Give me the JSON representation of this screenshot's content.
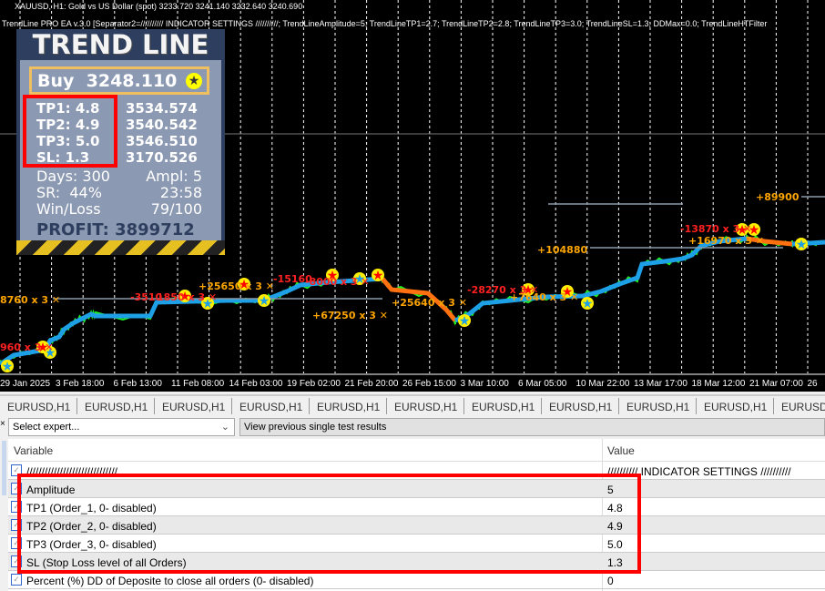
{
  "chart": {
    "header_line1": "XAUUSD, H1:  Gold vs US Dollar (spot)  3233.720 3241.140 3232.640 3240.690",
    "header_line2": "TrendLine PRO EA  v.3.0 [Separator2=////////// INDICATOR SETTINGS //////////; TrendLineAmplitude=5; TrendLineTP1=2.7; TrendLineTP2=2.8; TrendLineTP3=3.0; TrendLineSL=1.3; DDMax=0.0; TrendLineHTFilter",
    "x_ticks": [
      "29 Jan 2025",
      "3 Feb 18:00",
      "6 Feb 13:00",
      "11 Feb 08:00",
      "14 Feb 03:00",
      "19 Feb 02:00",
      "21 Feb 20:00",
      "26 Feb 15:00",
      "3 Mar 10:00",
      "6 Mar 05:00",
      "10 Mar 22:00",
      "13 Mar 17:00",
      "18 Mar 12:00",
      "21 Mar 07:00",
      "26"
    ],
    "trade_labels": [
      {
        "text": "8760 x 3",
        "color": "#ffa500"
      },
      {
        "text": "960 x 3",
        "color": "#ff2020"
      },
      {
        "text": "-3510",
        "color": "#ff2020"
      },
      {
        "text": "1850 x 3",
        "color": "#ff2020"
      },
      {
        "text": "+25650 x 3",
        "color": "#ffa500"
      },
      {
        "text": "-15160",
        "color": "#ff2020"
      },
      {
        "text": "-8000 x 3",
        "color": "#ff2020"
      },
      {
        "text": "+67250 x 3",
        "color": "#ffa500"
      },
      {
        "text": "+25640 x 3",
        "color": "#ffa500"
      },
      {
        "text": "-28270 x 3",
        "color": "#ff2020"
      },
      {
        "text": "+7640 x 3",
        "color": "#ffa500"
      },
      {
        "text": "+104880",
        "color": "#ffa500"
      },
      {
        "text": "-13870 x 3",
        "color": "#ff2020"
      },
      {
        "text": "+16970 x 3",
        "color": "#ffa500"
      },
      {
        "text": "+89900",
        "color": "#ffa500"
      }
    ]
  },
  "panel": {
    "title": "TREND LINE",
    "signal": "Buy",
    "price": "3248.110",
    "levels": [
      {
        "label": "TP1: 4.8",
        "value": "3534.574"
      },
      {
        "label": "TP2: 4.9",
        "value": "3540.542"
      },
      {
        "label": "TP3: 5.0",
        "value": "3546.510"
      },
      {
        "label": "SL: 1.3",
        "value": "3170.526"
      }
    ],
    "days": "Days: 300",
    "ampl": "Ampl: 5",
    "sr": "SR:  44%",
    "time": "23:58",
    "winloss_label": "Win/Loss",
    "winloss": "79/100",
    "profit": "PROFIT: 3899712"
  },
  "tabs": [
    "EURUSD,H1",
    "EURUSD,H1",
    "EURUSD,H1",
    "EURUSD,H1",
    "EURUSD,H1",
    "EURUSD,H1",
    "EURUSD,H1",
    "EURUSD,H1",
    "EURUSD,H1",
    "EURUSD,H1",
    "EURUSD,H1"
  ],
  "toolbar": {
    "expert_select": "Select expert...",
    "view_previous": "View previous single test results"
  },
  "table": {
    "headers": {
      "variable": "Variable",
      "value": "Value"
    },
    "rows": [
      {
        "variable": "//////////////////////////////",
        "value": "////////// INDICATOR SETTINGS //////////"
      },
      {
        "variable": "Amplitude",
        "value": "5"
      },
      {
        "variable": "TP1 (Order_1, 0- disabled)",
        "value": "4.8"
      },
      {
        "variable": "TP2 (Order_2, 0- disabled)",
        "value": "4.9"
      },
      {
        "variable": "TP3 (Order_3, 0- disabled)",
        "value": "5.0"
      },
      {
        "variable": "SL (Stop Loss level of all Orders)",
        "value": "1.3"
      },
      {
        "variable": "Percent (%) DD of Deposite to close all orders (0- disabled)",
        "value": "0"
      }
    ]
  }
}
